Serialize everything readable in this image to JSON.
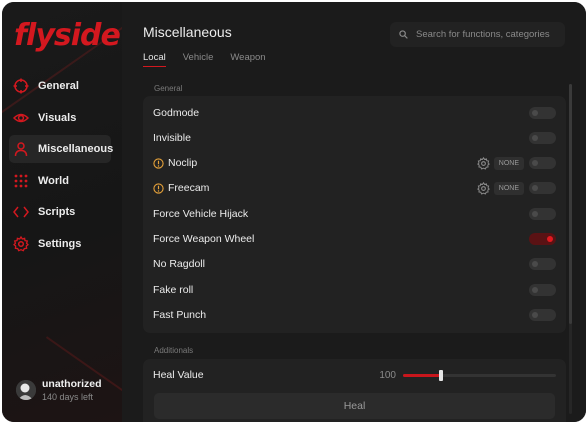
{
  "brand": {
    "logo_text": "flyside",
    "accent_color": "#d3181f"
  },
  "sidebar": {
    "items": [
      {
        "label": "General",
        "icon": "crosshair-icon"
      },
      {
        "label": "Visuals",
        "icon": "eye-icon"
      },
      {
        "label": "Miscellaneous",
        "icon": "user-icon",
        "active": true
      },
      {
        "label": "World",
        "icon": "grid-icon"
      },
      {
        "label": "Scripts",
        "icon": "code-icon"
      },
      {
        "label": "Settings",
        "icon": "gear-icon"
      }
    ]
  },
  "user": {
    "name": "unathorized",
    "subscription": "140 days left"
  },
  "header": {
    "title": "Miscellaneous",
    "search_placeholder": "Search for functions, categories"
  },
  "tabs": [
    {
      "label": "Local",
      "active": true
    },
    {
      "label": "Vehicle",
      "active": false
    },
    {
      "label": "Weapon",
      "active": false
    }
  ],
  "general": {
    "label": "General",
    "options": [
      {
        "label": "Godmode",
        "enabled": false
      },
      {
        "label": "Invisible",
        "enabled": false
      },
      {
        "label": "Noclip",
        "enabled": false,
        "warning": true,
        "keybind": "NONE"
      },
      {
        "label": "Freecam",
        "enabled": false,
        "warning": true,
        "keybind": "NONE"
      },
      {
        "label": "Force Vehicle Hijack",
        "enabled": false
      },
      {
        "label": "Force Weapon Wheel",
        "enabled": true
      },
      {
        "label": "No Ragdoll",
        "enabled": false
      },
      {
        "label": "Fake roll",
        "enabled": false
      },
      {
        "label": "Fast Punch",
        "enabled": false
      }
    ]
  },
  "additionals": {
    "label": "Additionals",
    "heal_value_label": "Heal Value",
    "heal_value": "100",
    "heal_slider_fraction": 0.25,
    "heal_button_label": "Heal"
  }
}
